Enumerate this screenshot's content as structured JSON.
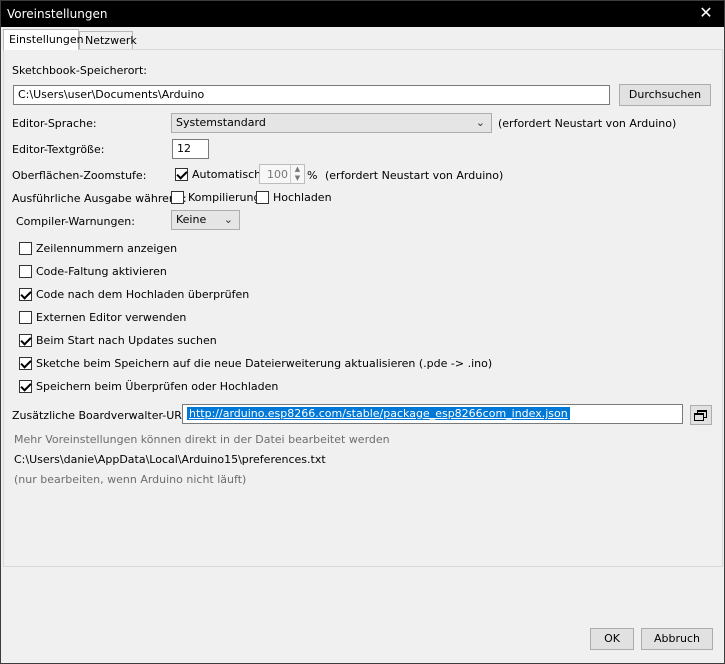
{
  "window": {
    "title": "Voreinstellungen",
    "close_glyph": "✕"
  },
  "tabs": [
    "Einstellungen",
    "Netzwerk"
  ],
  "sketchbook": {
    "label": "Sketchbook-Speicherort:",
    "value": "C:\\Users\\user\\Documents\\Arduino",
    "browse": "Durchsuchen"
  },
  "editor_language": {
    "label": "Editor-Sprache:",
    "value": "Systemstandard",
    "note": "(erfordert Neustart von Arduino)"
  },
  "editor_font_size": {
    "label": "Editor-Textgröße:",
    "value": "12"
  },
  "zoom": {
    "label": "Oberflächen-Zoomstufe:",
    "auto_label": "Automatisch",
    "auto_checked": true,
    "value": "100",
    "unit": "%",
    "note": "(erfordert Neustart von Arduino)"
  },
  "verbose": {
    "label": "Ausführliche Ausgabe während:",
    "compile_label": "Kompilierung",
    "compile_checked": false,
    "upload_label": "Hochladen",
    "upload_checked": false
  },
  "compiler_warnings": {
    "label": "Compiler-Warnungen:",
    "value": "Keine"
  },
  "options": [
    {
      "label": "Zeilennummern anzeigen",
      "checked": false
    },
    {
      "label": "Code-Faltung aktivieren",
      "checked": false
    },
    {
      "label": "Code nach dem Hochladen überprüfen",
      "checked": true
    },
    {
      "label": "Externen Editor verwenden",
      "checked": false
    },
    {
      "label": "Beim Start nach Updates suchen",
      "checked": true
    },
    {
      "label": "Sketche beim Speichern auf die neue Dateierweiterung aktualisieren (.pde -> .ino)",
      "checked": true
    },
    {
      "label": "Speichern beim Überprüfen oder Hochladen",
      "checked": true
    }
  ],
  "board_urls": {
    "label": "Zusätzliche Boardverwalter-URLs:",
    "value": "http://arduino.esp8266.com/stable/package_esp8266com_index.json",
    "icon": "window-list-icon"
  },
  "info": {
    "line1": "Mehr Voreinstellungen können direkt in der Datei bearbeitet werden",
    "path": "C:\\Users\\danie\\AppData\\Local\\Arduino15\\preferences.txt",
    "line3": "(nur bearbeiten, wenn Arduino nicht läuft)"
  },
  "footer": {
    "ok": "OK",
    "cancel": "Abbruch"
  }
}
